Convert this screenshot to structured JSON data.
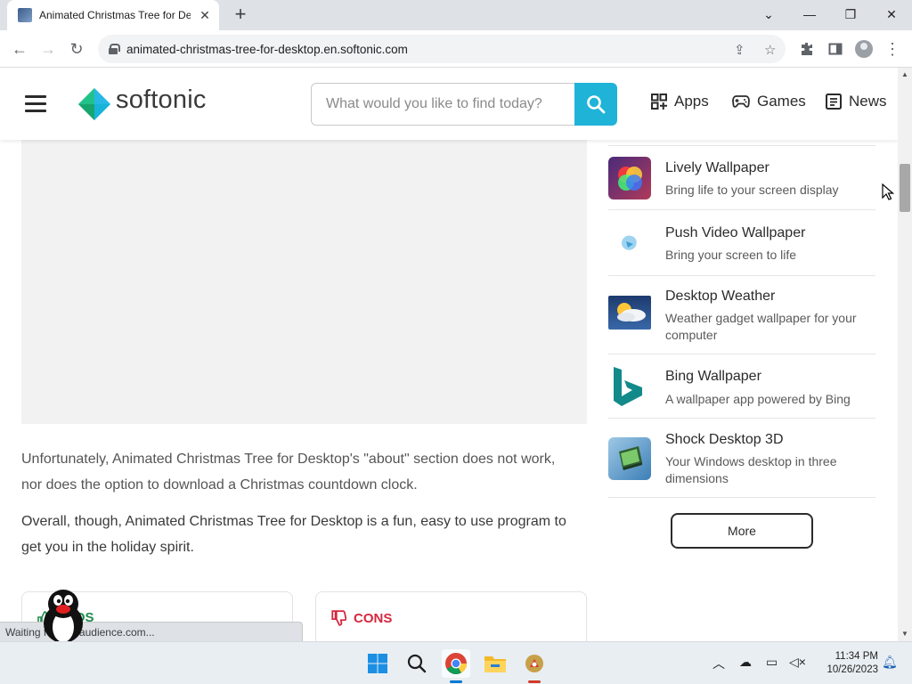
{
  "browser": {
    "tab_title": "Animated Christmas Tree for De",
    "url": "animated-christmas-tree-for-desktop.en.softonic.com",
    "status_text": "Waiting for ...chaudience.com..."
  },
  "site": {
    "logo_text": "softonic",
    "search_placeholder": "What would you like to find today?",
    "nav": [
      {
        "label": "Apps"
      },
      {
        "label": "Games"
      },
      {
        "label": "News"
      }
    ]
  },
  "article": {
    "para1": "Unfortunately, Animated Christmas Tree for Desktop's \"about\" section does not work, nor does the option to download a Christmas countdown clock.",
    "para2": "Overall, though, Animated Christmas Tree for Desktop is a fun, easy to use program to get you in the holiday spirit.",
    "pros_label": "PROS",
    "cons_label": "CONS"
  },
  "sidebar": {
    "items": [
      {
        "name": "Lively Wallpaper",
        "desc": "Bring life to your screen display",
        "icon": "lively-wallpaper-icon"
      },
      {
        "name": "Push Video Wallpaper",
        "desc": "Bring your screen to life",
        "icon": "push-video-wallpaper-icon"
      },
      {
        "name": "Desktop Weather",
        "desc": "Weather gadget wallpaper for your computer",
        "icon": "desktop-weather-icon"
      },
      {
        "name": "Bing Wallpaper",
        "desc": "A wallpaper app powered by Bing",
        "icon": "bing-icon"
      },
      {
        "name": "Shock Desktop 3D",
        "desc": "Your Windows desktop in three dimensions",
        "icon": "shock-desktop-icon"
      }
    ],
    "more_label": "More"
  },
  "taskbar": {
    "time": "11:34 PM",
    "date": "10/26/2023"
  },
  "colors": {
    "accent": "#1fb3d8",
    "pros": "#1f8a4c",
    "cons": "#d6263f"
  }
}
